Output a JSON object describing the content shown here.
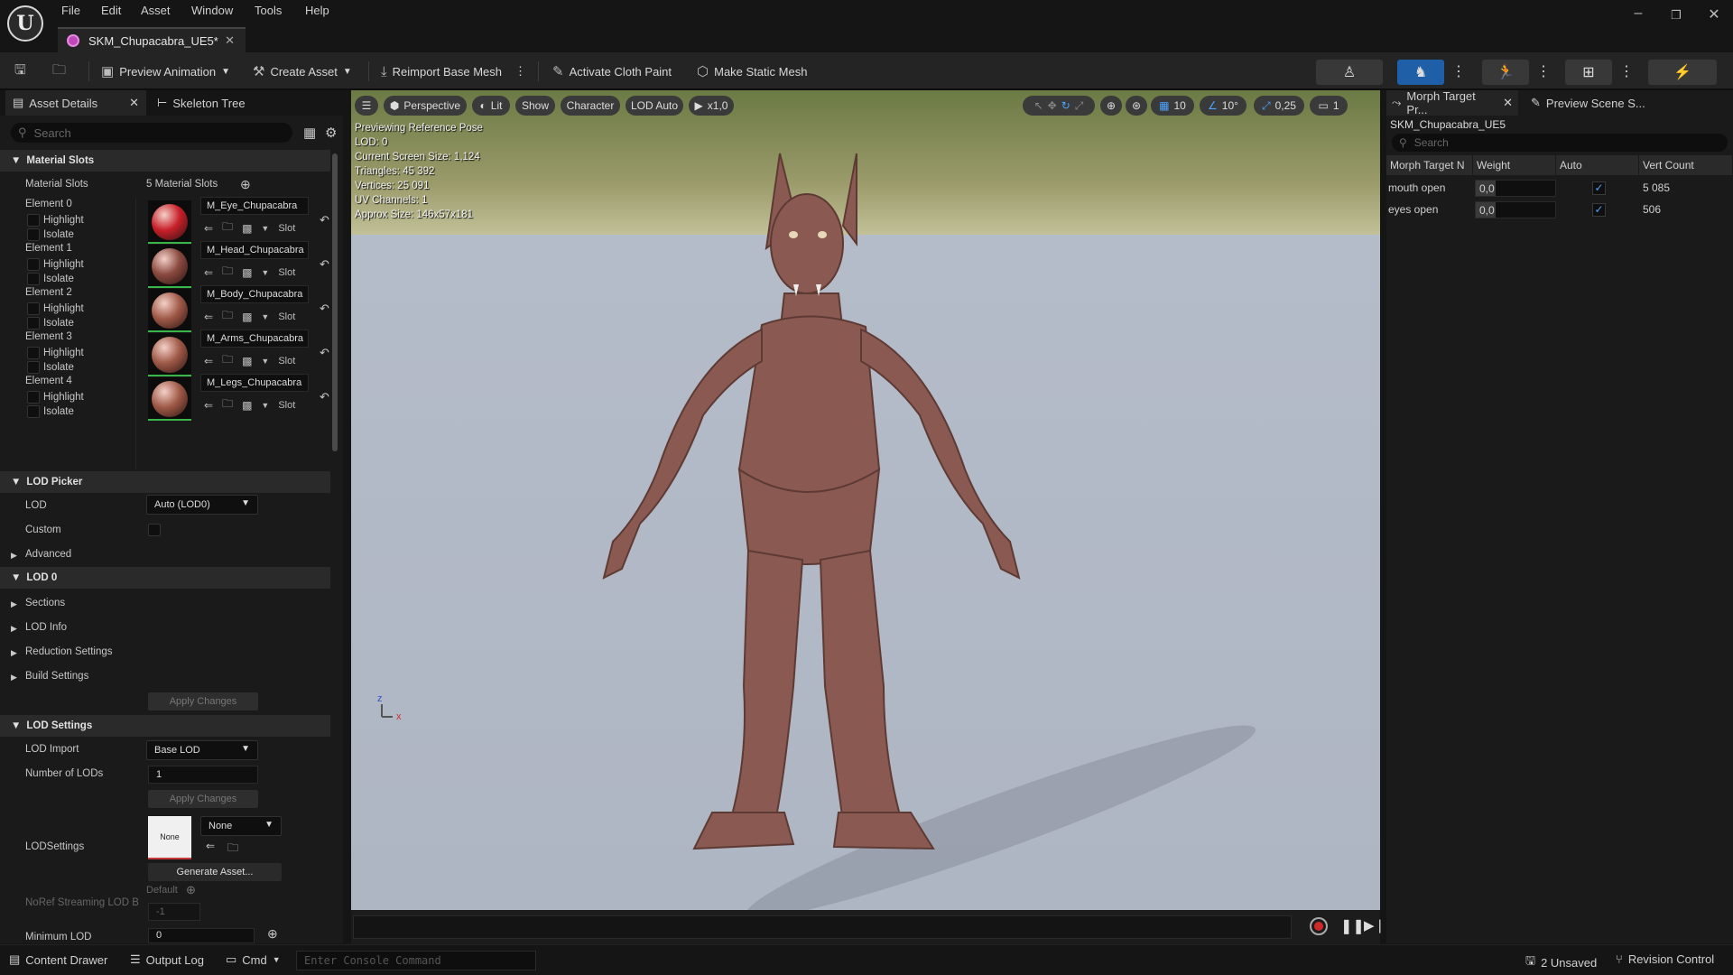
{
  "menu": {
    "file": "File",
    "edit": "Edit",
    "asset": "Asset",
    "window": "Window",
    "tools": "Tools",
    "help": "Help"
  },
  "document_tab": {
    "title": "SKM_Chupacabra_UE5*"
  },
  "toolbar": {
    "preview_animation": "Preview Animation",
    "create_asset": "Create Asset",
    "reimport": "Reimport Base Mesh",
    "cloth_paint": "Activate Cloth Paint",
    "make_static": "Make Static Mesh"
  },
  "left_panel": {
    "tab_details": "Asset Details",
    "tab_skeleton": "Skeleton Tree",
    "search_placeholder": "Search",
    "material_slots_header": "Material Slots",
    "material_slots_label": "Material Slots",
    "material_slots_count": "5 Material Slots",
    "highlight": "Highlight",
    "isolate": "Isolate",
    "slot": "Slot",
    "elements": [
      {
        "label": "Element 0",
        "material": "M_Eye_Chupacabra",
        "color": "#c8202a"
      },
      {
        "label": "Element 1",
        "material": "M_Head_Chupacabra",
        "color": "#8a4a40"
      },
      {
        "label": "Element 2",
        "material": "M_Body_Chupacabra",
        "color": "#a05a48"
      },
      {
        "label": "Element 3",
        "material": "M_Arms_Chupacabra",
        "color": "#a05a48"
      },
      {
        "label": "Element 4",
        "material": "M_Legs_Chupacabra",
        "color": "#a05a48"
      }
    ],
    "lod_picker_header": "LOD Picker",
    "lod_label": "LOD",
    "lod_value": "Auto (LOD0)",
    "custom_label": "Custom",
    "advanced_label": "Advanced",
    "lod0_header": "LOD 0",
    "sections": "Sections",
    "lod_info": "LOD Info",
    "reduction": "Reduction Settings",
    "build": "Build Settings",
    "apply_changes": "Apply Changes",
    "lod_settings_header": "LOD Settings",
    "lod_import_label": "LOD Import",
    "lod_import_value": "Base LOD",
    "num_lods_label": "Number of LODs",
    "num_lods_value": "1",
    "lodsettings_label": "LODSettings",
    "lodsettings_thumb": "None",
    "lodsettings_value": "None",
    "generate_asset": "Generate Asset...",
    "noref_label": "NoRef Streaming LOD B",
    "default_label": "Default",
    "noref_value": "-1",
    "min_lod_label": "Minimum LOD",
    "min_lod_value": "0"
  },
  "viewport": {
    "perspective": "Perspective",
    "lit": "Lit",
    "show": "Show",
    "character": "Character",
    "lod_auto": "LOD Auto",
    "play_rate": "x1,0",
    "grid": "10",
    "angle": "10°",
    "scale": "0,25",
    "camera": "1",
    "stats": [
      "Previewing Reference Pose",
      "LOD: 0",
      "Current Screen Size: 1,124",
      "Triangles: 45 392",
      "Vertices: 25 091",
      "UV Channels: 1",
      "Approx Size: 146x57x181"
    ],
    "axis_z": "z",
    "axis_x": "x"
  },
  "right_panel": {
    "tab_morph": "Morph Target Pr...",
    "tab_scene": "Preview Scene S...",
    "asset_name": "SKM_Chupacabra_UE5",
    "search_placeholder": "Search",
    "columns": [
      "Morph Target N",
      "Weight",
      "Auto",
      "Vert Count"
    ],
    "rows": [
      {
        "name": "mouth open",
        "weight": "0,0",
        "auto": "✓",
        "verts": "5 085"
      },
      {
        "name": "eyes open",
        "weight": "0,0",
        "auto": "✓",
        "verts": "506"
      }
    ]
  },
  "status": {
    "content_drawer": "Content Drawer",
    "output_log": "Output Log",
    "cmd": "Cmd",
    "console_placeholder": "Enter Console Command",
    "unsaved": "2 Unsaved",
    "revision": "Revision Control"
  }
}
